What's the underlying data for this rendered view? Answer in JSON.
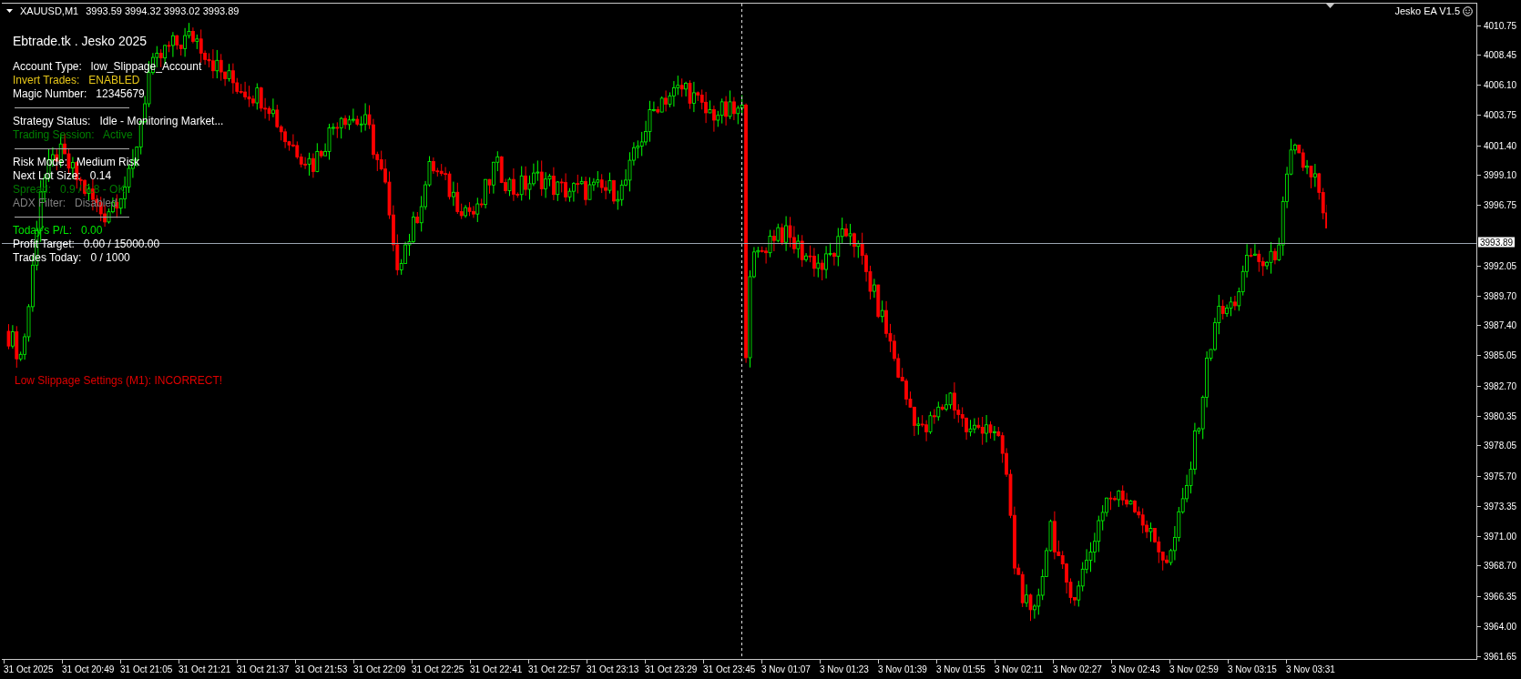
{
  "chart": {
    "header": {
      "symbol": "XAUUSD,M1",
      "quotes": "3993.59 3994.32 3993.02 3993.89"
    },
    "expert": {
      "label": "Jesko EA V1.5"
    },
    "panel": {
      "title": "Ebtrade.tk . Jesko 2025",
      "rows": [
        {
          "kind": "text",
          "label": "Account Type:",
          "value": "low_Slippage_Account",
          "color": "#ffffff"
        },
        {
          "kind": "text",
          "label": "Invert Trades:",
          "value": "ENABLED",
          "color": "#e6c619"
        },
        {
          "kind": "text",
          "label": "Magic Number:",
          "value": "12345679",
          "color": "#ffffff"
        },
        {
          "kind": "separator"
        },
        {
          "kind": "text",
          "label": "Strategy Status:",
          "value": "Idle - Monitoring Market...",
          "color": "#ffffff"
        },
        {
          "kind": "text",
          "label": "Trading Session:",
          "value": "Active",
          "color": "#008000"
        },
        {
          "kind": "separator"
        },
        {
          "kind": "text",
          "label": "Risk Mode:",
          "value": "Medium Risk",
          "color": "#ffffff"
        },
        {
          "kind": "text",
          "label": "Next Lot Size:",
          "value": "0.14",
          "color": "#ffffff"
        },
        {
          "kind": "text",
          "label": "Spread:",
          "value": "0.9 / 0.8 - OK",
          "color": "#007a00"
        },
        {
          "kind": "text",
          "label": "ADX Filter:",
          "value": "Disabled",
          "color": "#808080"
        },
        {
          "kind": "separator"
        },
        {
          "kind": "text",
          "label": "Today's P/L:",
          "value": "0.00",
          "color": "#00e600"
        },
        {
          "kind": "text",
          "label": "Profit Target:",
          "value": "0.00 / 15000.00",
          "color": "#ffffff"
        },
        {
          "kind": "text",
          "label": "Trades Today:",
          "value": "0 / 1000",
          "color": "#ffffff"
        }
      ]
    },
    "warning": {
      "text": "Low Slippage Settings (M1): INCORRECT!",
      "color": "#e00000"
    },
    "current_price": "3993.89"
  },
  "price_axis": [
    "4010.75",
    "4008.45",
    "4006.10",
    "4003.75",
    "4001.40",
    "3999.10",
    "3996.75",
    "3992.05",
    "3989.70",
    "3987.40",
    "3985.05",
    "3982.70",
    "3980.35",
    "3978.05",
    "3975.70",
    "3973.35",
    "3971.00",
    "3968.70",
    "3966.35",
    "3964.00",
    "3961.65"
  ],
  "time_axis": [
    "31 Oct 2025",
    "31 Oct 20:49",
    "31 Oct 21:05",
    "31 Oct 21:21",
    "31 Oct 21:37",
    "31 Oct 21:53",
    "31 Oct 22:09",
    "31 Oct 22:25",
    "31 Oct 22:41",
    "31 Oct 22:57",
    "31 Oct 23:13",
    "31 Oct 23:29",
    "31 Oct 23:45",
    "3 Nov 01:07",
    "3 Nov 01:23",
    "3 Nov 01:39",
    "3 Nov 01:55",
    "3 Nov 02:11",
    "3 Nov 02:27",
    "3 Nov 02:43",
    "3 Nov 02:59",
    "3 Nov 03:15",
    "3 Nov 03:31"
  ]
}
